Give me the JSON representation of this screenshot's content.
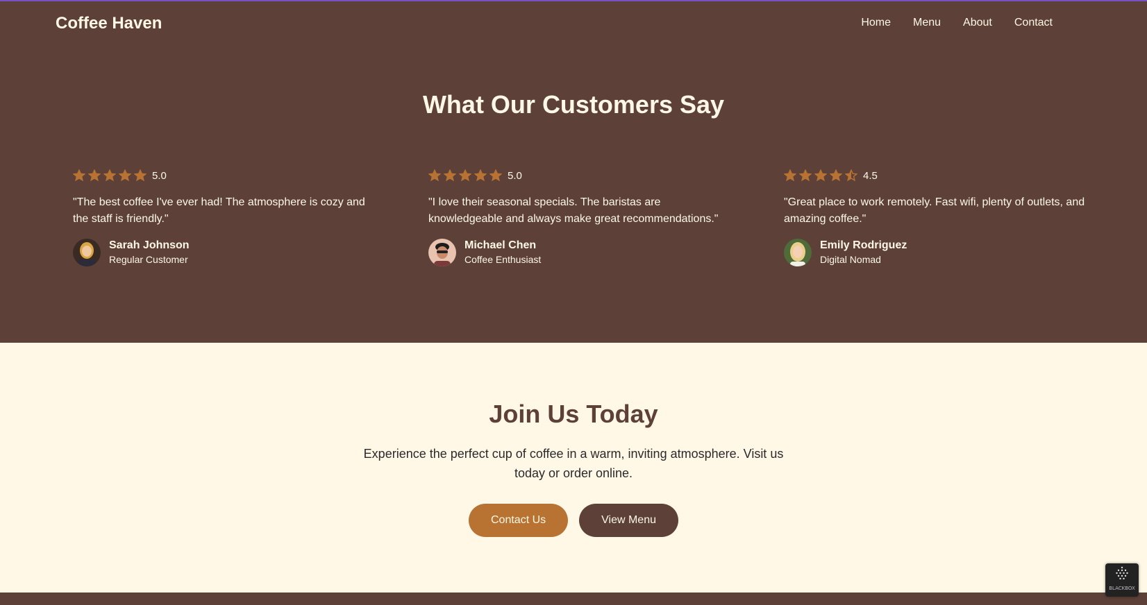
{
  "brand": "Coffee Haven",
  "nav": [
    "Home",
    "Menu",
    "About",
    "Contact"
  ],
  "testimonials": {
    "title": "What Our Customers Say",
    "items": [
      {
        "rating": "5.0",
        "stars": 5,
        "quote": "\"The best coffee I've ever had! The atmosphere is cozy and the staff is friendly.\"",
        "name": "Sarah Johnson",
        "role": "Regular Customer"
      },
      {
        "rating": "5.0",
        "stars": 5,
        "quote": "\"I love their seasonal specials. The baristas are knowledgeable and always make great recommendations.\"",
        "name": "Michael Chen",
        "role": "Coffee Enthusiast"
      },
      {
        "rating": "4.5",
        "stars": 4.5,
        "quote": "\"Great place to work remotely. Fast wifi, plenty of outlets, and amazing coffee.\"",
        "name": "Emily Rodriguez",
        "role": "Digital Nomad"
      }
    ]
  },
  "cta": {
    "title": "Join Us Today",
    "text": "Experience the perfect cup of coffee in a warm, inviting atmosphere. Visit us today or order online.",
    "primary": "Contact Us",
    "secondary": "View Menu"
  },
  "badge": {
    "label": "BLACKBOX",
    "icon": "blackbox-logo-icon"
  },
  "colors": {
    "header_bg": "#5d4037",
    "accent": "#b87333",
    "cream": "#fff8e7",
    "top_line": "#7b4fc4"
  }
}
